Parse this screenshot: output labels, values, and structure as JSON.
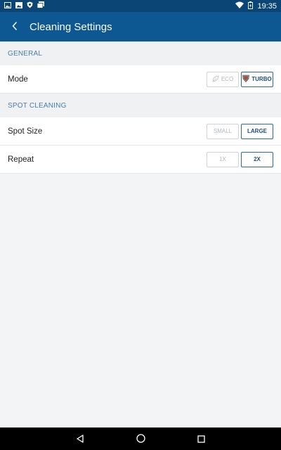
{
  "status_bar": {
    "time": "19:35",
    "icons_left": [
      "image-icon",
      "gallery-icon",
      "shield-notification-icon",
      "stacked-photos-icon"
    ],
    "icons_right": [
      "wifi-icon",
      "battery-icon"
    ]
  },
  "app_bar": {
    "title": "Cleaning Settings",
    "back_icon": "chevron-left-icon"
  },
  "sections": [
    {
      "header": "GENERAL",
      "rows": [
        {
          "label": "Mode",
          "options": [
            {
              "label": "ECO",
              "icon": "leaf-icon",
              "active": false
            },
            {
              "label": "TURBO",
              "icon": "turbo-shield-icon",
              "active": true
            }
          ]
        }
      ]
    },
    {
      "header": "SPOT CLEANING",
      "rows": [
        {
          "label": "Spot Size",
          "options": [
            {
              "label": "SMALL",
              "active": false
            },
            {
              "label": "LARGE",
              "active": true
            }
          ]
        },
        {
          "label": "Repeat",
          "options": [
            {
              "label": "1X",
              "active": false
            },
            {
              "label": "2X",
              "active": true
            }
          ]
        }
      ]
    }
  ],
  "nav_bar": {
    "buttons": [
      "back-triangle-icon",
      "home-circle-icon",
      "recents-square-icon"
    ]
  },
  "colors": {
    "status_bar": "#0a4575",
    "app_bar": "#0d5892",
    "section_text": "#4b7ea7",
    "active_border": "#2c6a9b",
    "background": "#f3f4f6"
  }
}
